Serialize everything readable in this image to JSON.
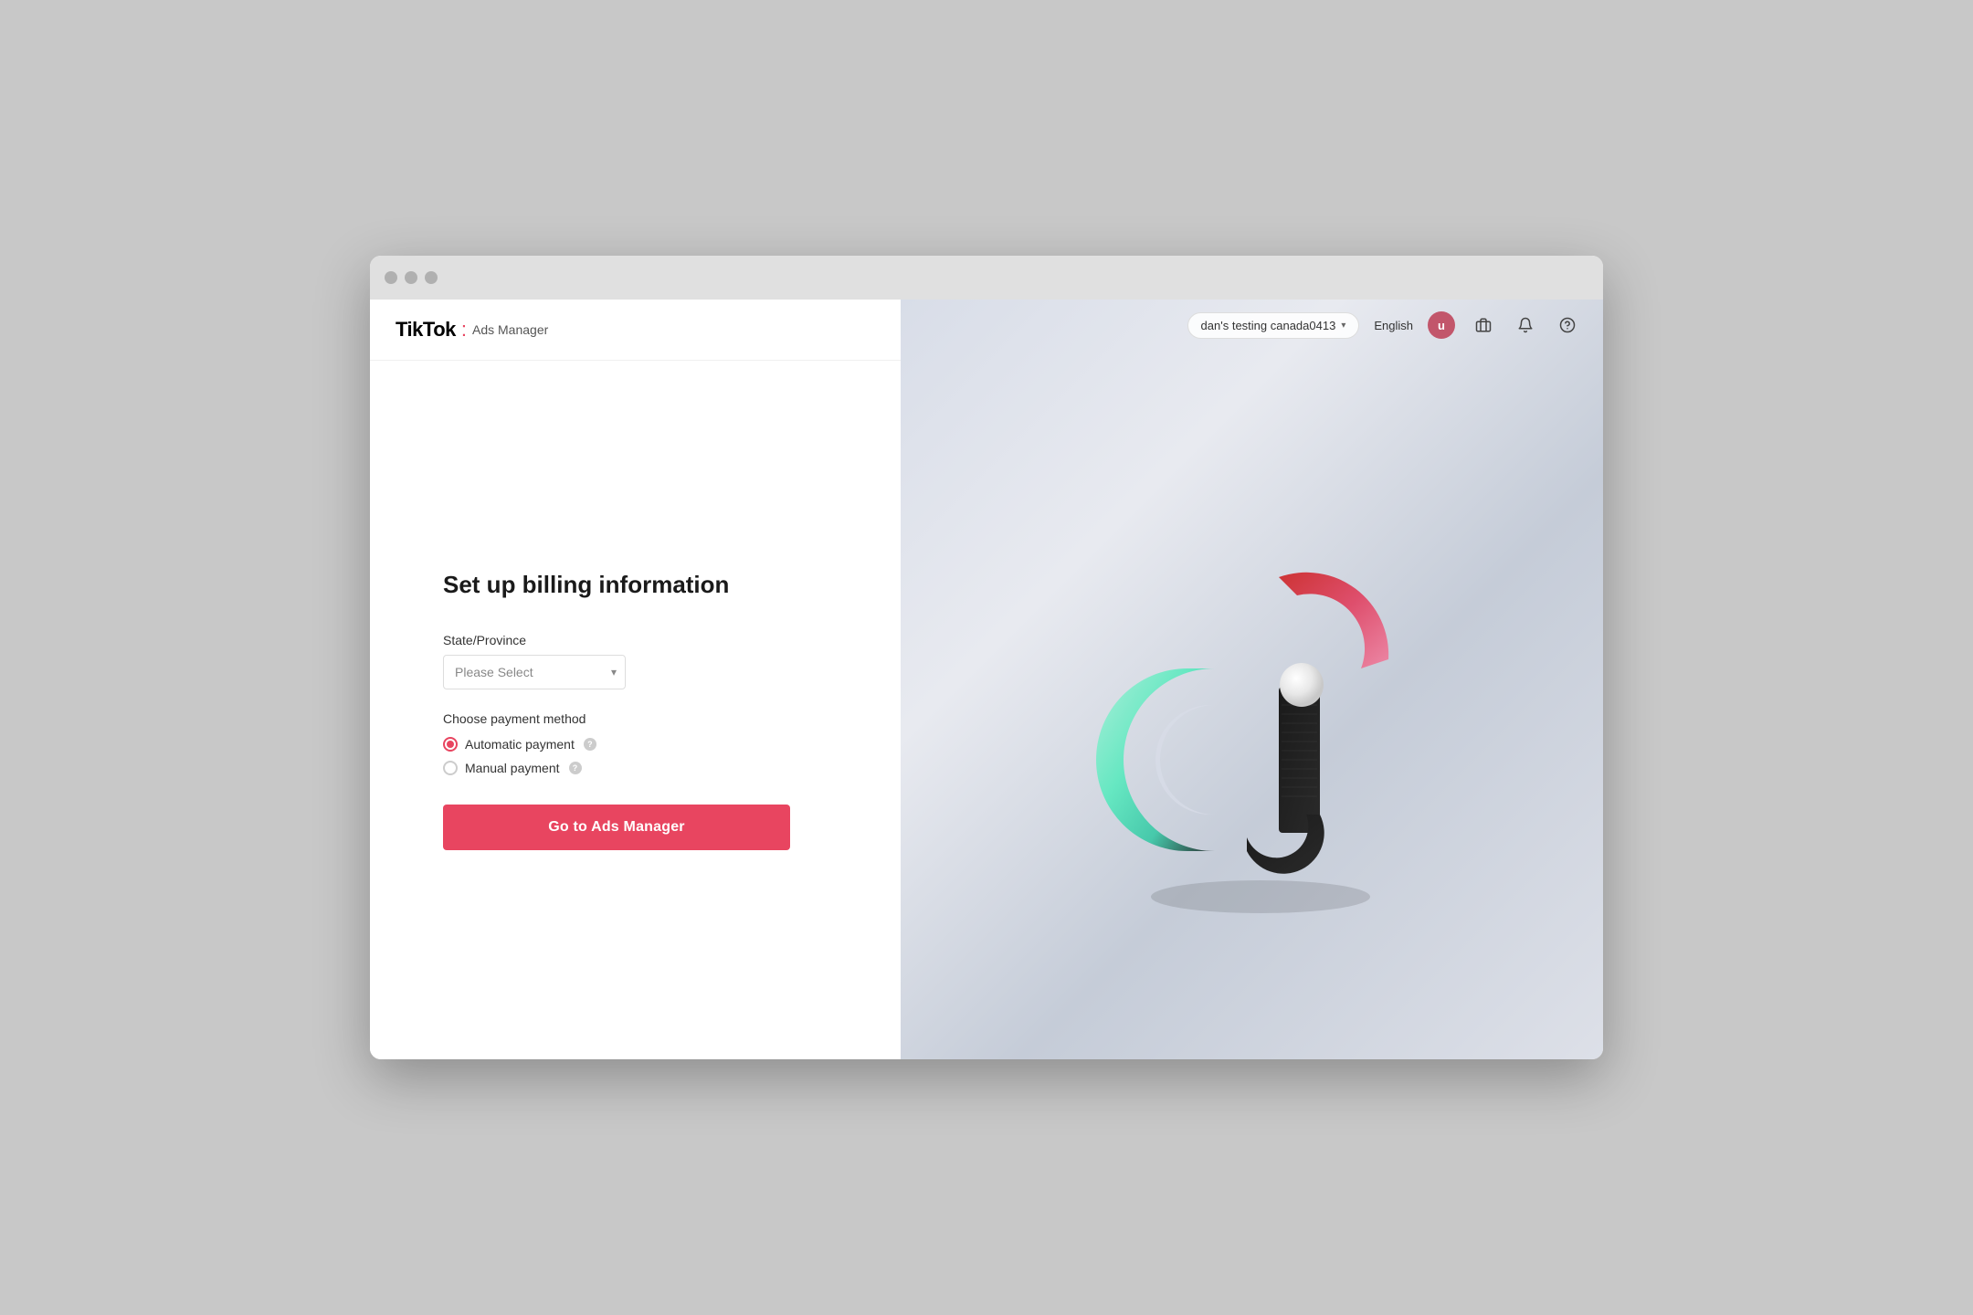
{
  "window": {
    "title": "TikTok Ads Manager"
  },
  "header": {
    "logo_tiktok": "TikTok",
    "logo_separator": ":",
    "logo_ads": "Ads Manager"
  },
  "topbar": {
    "account_name": "dan's testing canada0413",
    "language": "English",
    "avatar_letter": "u"
  },
  "form": {
    "title": "Set up billing information",
    "state_label": "State/Province",
    "state_placeholder": "Please Select",
    "payment_method_label": "Choose payment method",
    "payment_options": [
      {
        "id": "automatic",
        "label": "Automatic payment",
        "checked": true
      },
      {
        "id": "manual",
        "label": "Manual payment",
        "checked": false
      }
    ],
    "cta_label": "Go to Ads Manager"
  }
}
